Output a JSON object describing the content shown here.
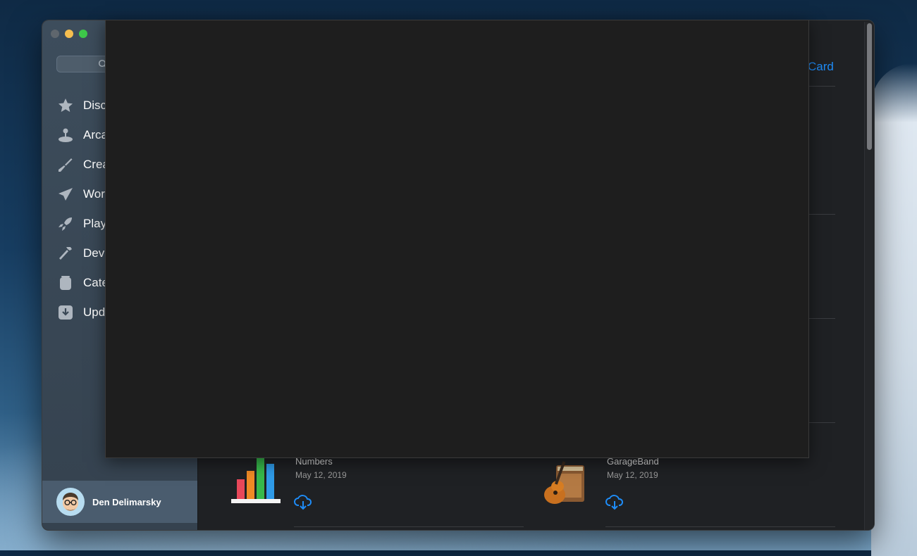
{
  "sidebar": {
    "search_placeholder": "Search",
    "items": [
      {
        "label": "Discover",
        "icon": "star-icon"
      },
      {
        "label": "Arcade",
        "icon": "joystick-icon"
      },
      {
        "label": "Create",
        "icon": "brush-icon"
      },
      {
        "label": "Work",
        "icon": "paper-plane-icon"
      },
      {
        "label": "Play",
        "icon": "rocket-icon"
      },
      {
        "label": "Develop",
        "icon": "hammer-icon"
      },
      {
        "label": "Categories",
        "icon": "stack-icon"
      },
      {
        "label": "Updates",
        "icon": "download-icon"
      }
    ],
    "user_name": "Den Delimarsky"
  },
  "main": {
    "redeem_label": "Card",
    "apps": [
      {
        "name": "Numbers",
        "date": "May 12, 2019",
        "icon": "numbers-app-icon"
      },
      {
        "name": "GarageBand",
        "date": "May 12, 2019",
        "icon": "garageband-app-icon"
      }
    ]
  },
  "colors": {
    "accent": "#1e8cf7",
    "sidebar": "#3d4d5c",
    "content_bg": "#1f2124",
    "overlay_bg": "#1e1e1e"
  }
}
